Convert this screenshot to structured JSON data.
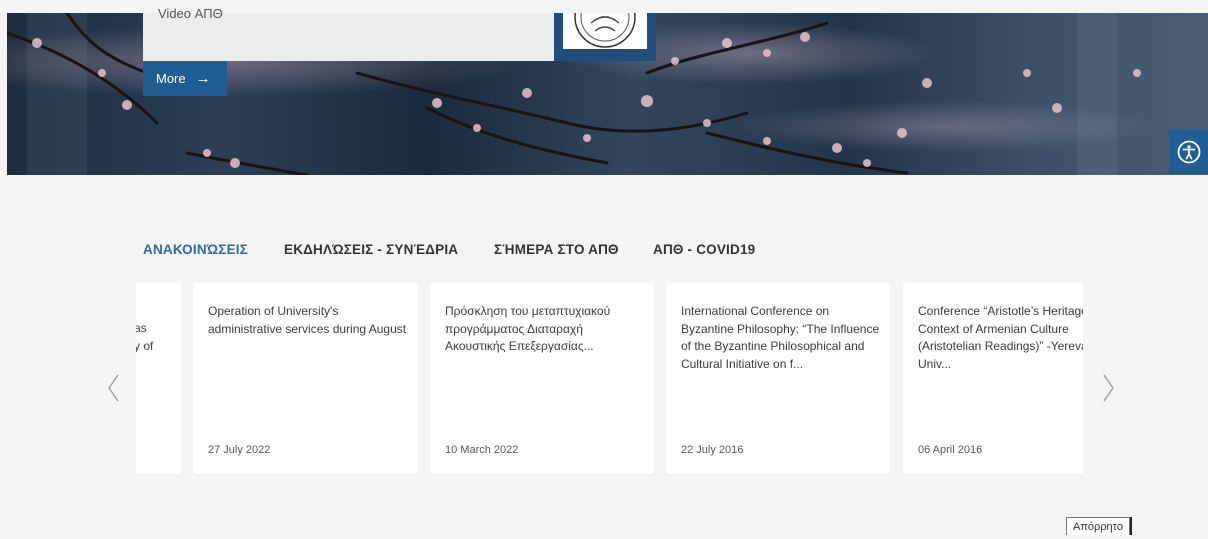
{
  "hero": {
    "caption": "Video ΑΠΘ",
    "more_label": "More",
    "more_arrow": "→"
  },
  "accessibility": {
    "icon": "accessibility-icon"
  },
  "tabs": [
    {
      "label": "ΑΝΑΚΟΙΝΏΣΕΙΣ",
      "active": true
    },
    {
      "label": "ΕΚΔΗΛΏΣΕΙΣ - ΣΥΝΈΔΡΙΑ",
      "active": false
    },
    {
      "label": "ΣΉΜΕΡΑ ΣΤΟ ΑΠΘ",
      "active": false
    },
    {
      "label": "ΑΠΘ - COVID19",
      "active": false
    }
  ],
  "cards": [
    {
      "title_lines": [
        "as",
        "y of"
      ],
      "date": ""
    },
    {
      "title": "Operation of University's administrative services during August",
      "date": "27 July 2022"
    },
    {
      "title": "Πρόσκληση του μεταπτυχιακού προγράμματος Διαταραχή Ακουστικής Επεξεργασίας...",
      "date": "10 March 2022"
    },
    {
      "title": "International Conference on Byzantine Philosophy: “The Influence of the Byzantine Philosophical and Cultural Initiative on f...",
      "date": "22 July 2016"
    },
    {
      "title": "Conference “Aristotle’s Heritage in the Context of Armenian Culture (Aristotelian Readings)” -Yerevan State Univ...",
      "date": "06 April 2016"
    }
  ],
  "carousel": {
    "prev_icon": "chevron-left-icon",
    "next_icon": "chevron-right-icon"
  },
  "privacy_label": "Απόρρητο",
  "colors": {
    "accent": "#1f5d93",
    "tab_active": "#2c6aa3",
    "background": "#f4f4f4"
  }
}
